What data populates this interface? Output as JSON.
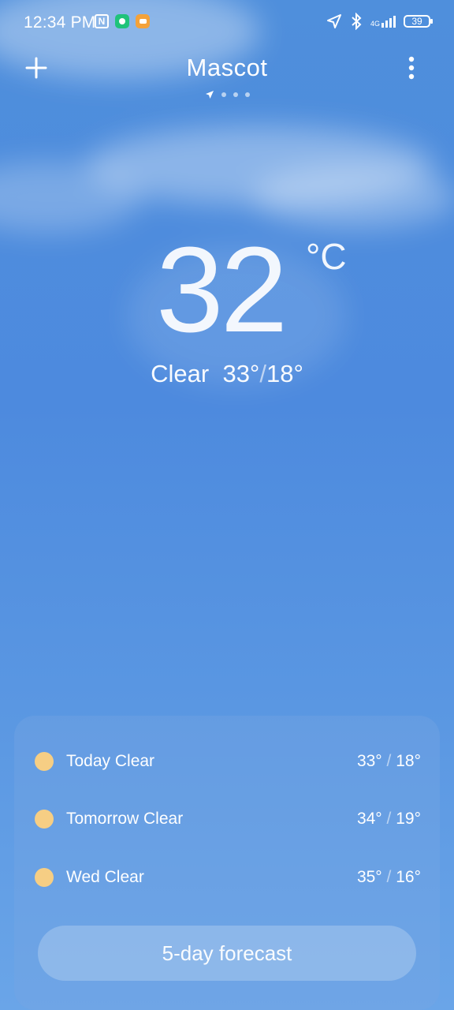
{
  "status_bar": {
    "time": "12:34 PM",
    "network": "4G",
    "battery": "39",
    "icons": [
      "nfc-icon",
      "shield-icon",
      "message-icon",
      "location-icon",
      "bluetooth-icon",
      "signal-icon",
      "battery-icon"
    ]
  },
  "header": {
    "city": "Mascot",
    "add_icon": "plus-icon",
    "menu_icon": "more-vertical-icon",
    "page_indicator_icons": [
      "location-arrow-icon",
      "dot",
      "dot",
      "dot"
    ]
  },
  "current": {
    "temperature": "32",
    "unit": "°C",
    "condition": "Clear",
    "high": "33°",
    "low": "18°"
  },
  "forecast": {
    "days": [
      {
        "label": "Today  Clear",
        "high": "33°",
        "low": "18°",
        "icon": "sun-icon"
      },
      {
        "label": "Tomorrow  Clear",
        "high": "34°",
        "low": "19°",
        "icon": "sun-icon"
      },
      {
        "label": "Wed  Clear",
        "high": "35°",
        "low": "16°",
        "icon": "sun-icon"
      }
    ],
    "button_label": "5-day forecast"
  },
  "colors": {
    "sky_top": "#4f8fdc",
    "sky_bottom": "#6aa5e8",
    "sun": "#f6ce84"
  }
}
